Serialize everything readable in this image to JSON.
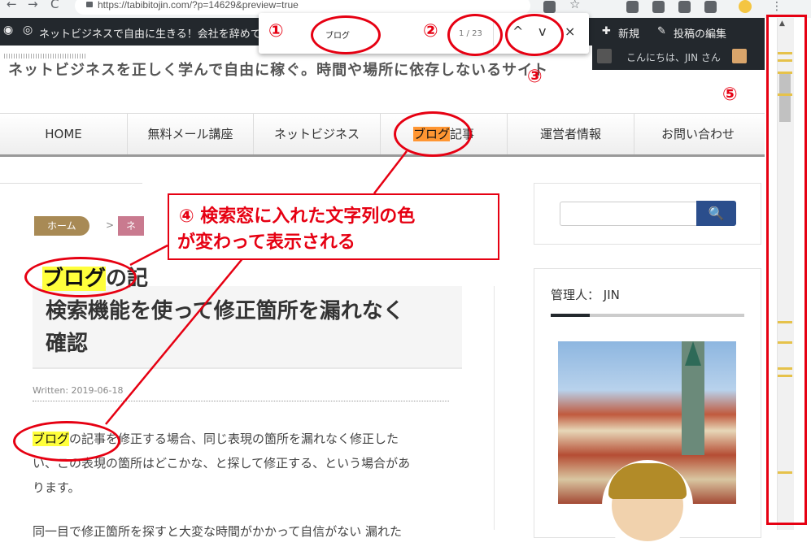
{
  "browser": {
    "url": "https://tabibitojin.com/?p=14629&preview=true",
    "back_icon": "←",
    "forward_icon": "→",
    "reload_icon": "C",
    "star_icon": "☆"
  },
  "adminbar": {
    "site_title": "ネットビジネスで自由に生きる！会社を辞めて",
    "new_label": "新規",
    "edit_label": "投稿の編集",
    "greeting": "こんにちは、JIN さん"
  },
  "findbar": {
    "query": "ブログ",
    "count": "1 / 23",
    "prev_icon": "^",
    "next_icon": "v",
    "close_icon": "×"
  },
  "header": {
    "tagline": "ネットビジネスを正しく学んで自由に稼ぐ。時間や場所に依存しないるサイト"
  },
  "nav": {
    "items": [
      "HOME",
      "無料メール講座",
      "ネットビジネス",
      "ブログ",
      "記事",
      "運営者情報",
      "お問い合わせ"
    ]
  },
  "breadcrumb": {
    "home": "ホーム",
    "sep": ">",
    "next": "ネ"
  },
  "article": {
    "title_hl": "ブログ",
    "title_rest": "の記",
    "title_line2": "検索機能を使って修正箇所を漏れなく",
    "title_line3": "確認",
    "written": "Written: 2019-06-18",
    "para1_hl": "ブログ",
    "para1_rest": "の記事を修正する場合、同じ表現の箇所を漏れなく修正した",
    "para1_line2": "い、この表現の箇所はどこかな、と探して修正する、という場合があ",
    "para1_line3": "ります。",
    "para2": "同一目で修正箇所を探すと大変な時間がかかって自信がない 漏れた"
  },
  "sidebar": {
    "search_icon": "🔍",
    "admin_title": "管理人： JIN"
  },
  "annotations": {
    "n1": "①",
    "n2": "②",
    "n3": "③",
    "n4_line1": "④ 検索窓に入れた文字列の色",
    "n4_line2": "が変わって表示される",
    "n5": "⑤",
    "color": "#e60012"
  },
  "colors": {
    "highlight": "#ffff3c",
    "current_highlight": "#ff9632",
    "adminbar_bg": "#23282d",
    "search_button": "#2b4e8c"
  }
}
